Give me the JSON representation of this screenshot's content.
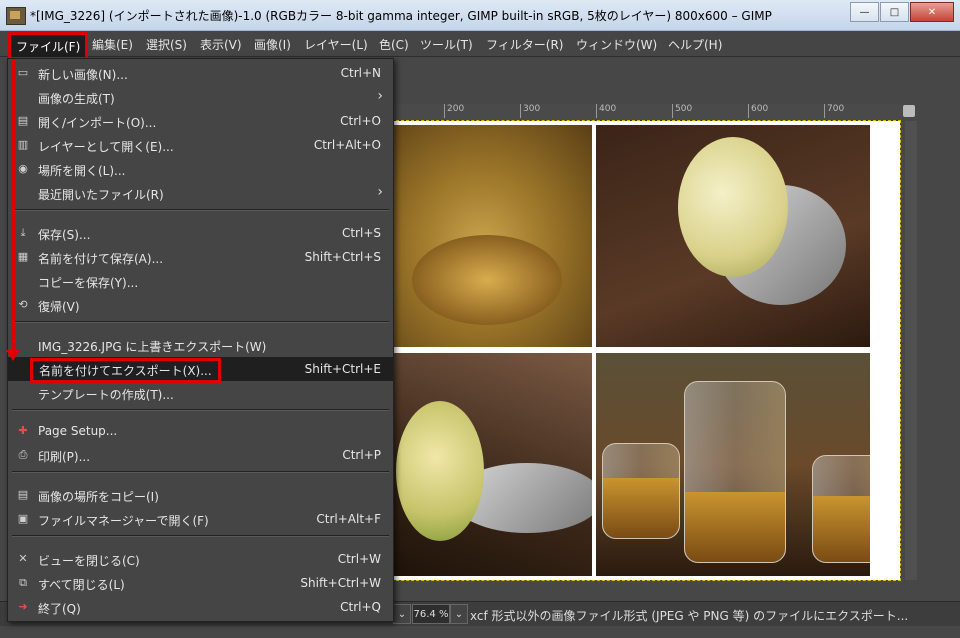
{
  "window": {
    "title": "*[IMG_3226] (インポートされた画像)-1.0 (RGBカラー 8-bit gamma integer, GIMP built-in sRGB, 5枚のレイヤー) 800x600 – GIMP",
    "minimize": "—",
    "maximize": "□",
    "close": "✕"
  },
  "menubar": [
    "ファイル(F)",
    "編集(E)",
    "選択(S)",
    "表示(V)",
    "画像(I)",
    "レイヤー(L)",
    "色(C)",
    "ツール(T)",
    "フィルター(R)",
    "ウィンドウ(W)",
    "ヘルプ(H)"
  ],
  "ruler": [
    "200",
    "300",
    "400",
    "500",
    "600",
    "700"
  ],
  "file_menu": {
    "items": [
      {
        "label": "新しい画像(N)...",
        "shortcut": "Ctrl+N"
      },
      {
        "label": "画像の生成(T)",
        "shortcut": "",
        "submenu": "›"
      },
      {
        "label": "開く/インポート(O)...",
        "shortcut": "Ctrl+O"
      },
      {
        "label": "レイヤーとして開く(E)...",
        "shortcut": "Ctrl+Alt+O"
      },
      {
        "label": "場所を開く(L)...",
        "shortcut": ""
      },
      {
        "label": "最近開いたファイル(R)",
        "shortcut": "",
        "submenu": "›"
      },
      {
        "label": "保存(S)...",
        "shortcut": "Ctrl+S"
      },
      {
        "label": "名前を付けて保存(A)...",
        "shortcut": "Shift+Ctrl+S"
      },
      {
        "label": "コピーを保存(Y)...",
        "shortcut": ""
      },
      {
        "label": "復帰(V)",
        "shortcut": ""
      },
      {
        "label": "IMG_3226.JPG に上書きエクスポート(W)",
        "shortcut": ""
      },
      {
        "label": "名前を付けてエクスポート(X)...",
        "shortcut": "Shift+Ctrl+E"
      },
      {
        "label": "テンプレートの作成(T)...",
        "shortcut": ""
      },
      {
        "label": "Page Setup...",
        "shortcut": ""
      },
      {
        "label": "印刷(P)...",
        "shortcut": "Ctrl+P"
      },
      {
        "label": "画像の場所をコピー(I)",
        "shortcut": ""
      },
      {
        "label": "ファイルマネージャーで開く(F)",
        "shortcut": "Ctrl+Alt+F"
      },
      {
        "label": "ビューを閉じる(C)",
        "shortcut": "Ctrl+W"
      },
      {
        "label": "すべて閉じる(L)",
        "shortcut": "Shift+Ctrl+W"
      },
      {
        "label": "終了(Q)",
        "shortcut": "Ctrl+Q"
      }
    ]
  },
  "statusbar": {
    "zoom": "76.4 %",
    "dropdown": "⌄",
    "message": "xcf 形式以外の画像ファイル形式 (JPEG や PNG 等) のファイルにエクスポート..."
  }
}
